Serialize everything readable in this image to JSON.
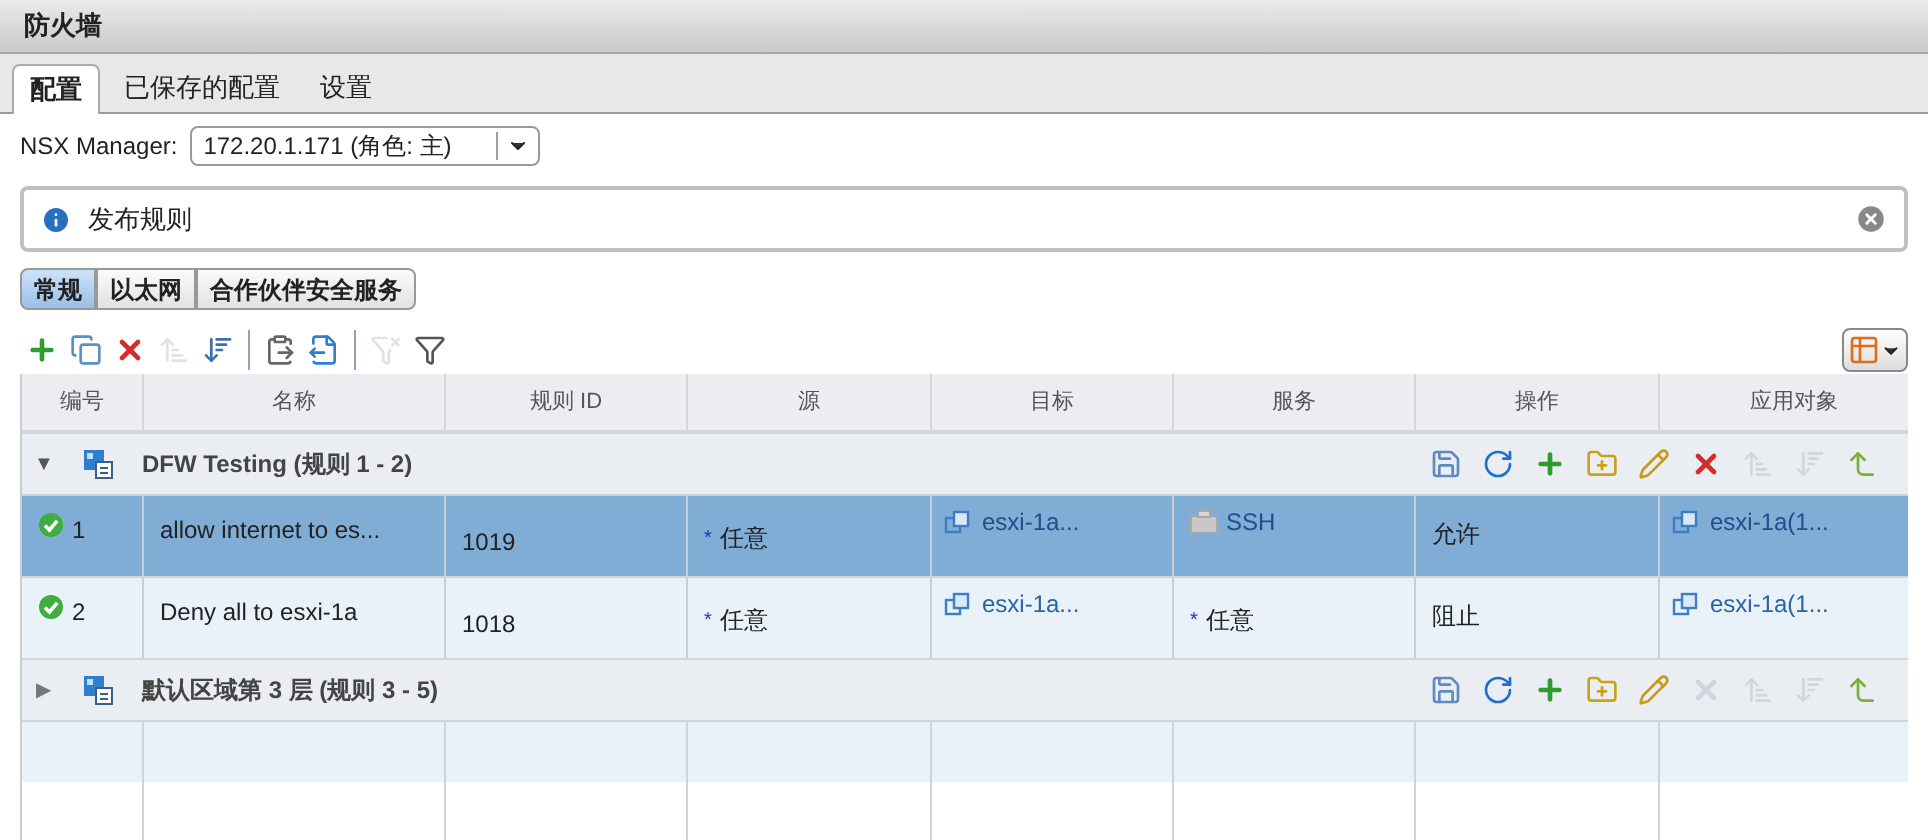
{
  "window": {
    "title": "防火墙"
  },
  "tabs": [
    {
      "label": "配置",
      "selected": true
    },
    {
      "label": "已保存的配置",
      "selected": false
    },
    {
      "label": "设置",
      "selected": false
    }
  ],
  "nsx_manager": {
    "label": "NSX Manager:",
    "value": "172.20.1.171 (角色: 主)"
  },
  "info_bar": {
    "message": "发布规则"
  },
  "section_tabs": [
    {
      "label": "常规",
      "selected": true
    },
    {
      "label": "以太网",
      "selected": false
    },
    {
      "label": "合作伙伴安全服务",
      "selected": false
    }
  ],
  "toolbar_groups": [
    {
      "buttons": [
        {
          "kind": "add",
          "disabled": false
        },
        {
          "kind": "copy",
          "disabled": false
        },
        {
          "kind": "delete",
          "disabled": false
        },
        {
          "kind": "move_up",
          "disabled": true
        },
        {
          "kind": "move_down",
          "disabled": false
        }
      ]
    },
    {
      "buttons": [
        {
          "kind": "paste",
          "disabled": false
        },
        {
          "kind": "export",
          "disabled": false
        }
      ]
    },
    {
      "buttons": [
        {
          "kind": "clear_filter",
          "disabled": true
        },
        {
          "kind": "add_filter",
          "disabled": false
        }
      ]
    }
  ],
  "table": {
    "columns": [
      "编号",
      "名称",
      "规则 ID",
      "源",
      "目标",
      "服务",
      "操作",
      "应用对象"
    ],
    "sections": [
      {
        "title": "DFW Testing (规则 1 - 2)",
        "expanded": true,
        "toggle": "▼",
        "actions": [
          {
            "kind": "save",
            "disabled": false
          },
          {
            "kind": "refresh",
            "disabled": false
          },
          {
            "kind": "add",
            "disabled": false
          },
          {
            "kind": "add_section",
            "disabled": false
          },
          {
            "kind": "edit",
            "disabled": false
          },
          {
            "kind": "delete",
            "disabled": false
          },
          {
            "kind": "move_up",
            "disabled": true
          },
          {
            "kind": "move_down",
            "disabled": true
          },
          {
            "kind": "promote",
            "disabled": false
          }
        ],
        "rules": [
          {
            "number": "1",
            "enabled": true,
            "selected": true,
            "name": "allow internet to es...",
            "rule_id": "1019",
            "source": {
              "kind": "any",
              "mark": "*",
              "text": "任意"
            },
            "destination": {
              "kind": "object",
              "text": "esxi-1a..."
            },
            "service": {
              "kind": "service",
              "text": "SSH"
            },
            "action": "允许",
            "applied_to": {
              "kind": "object",
              "text": "esxi-1a(1..."
            }
          },
          {
            "number": "2",
            "enabled": true,
            "selected": false,
            "name": "Deny all to esxi-1a",
            "rule_id": "1018",
            "source": {
              "kind": "any",
              "mark": "*",
              "text": "任意"
            },
            "destination": {
              "kind": "object",
              "text": "esxi-1a..."
            },
            "service": {
              "kind": "any",
              "mark": "*",
              "text": "任意"
            },
            "action": "阻止",
            "applied_to": {
              "kind": "object",
              "text": "esxi-1a(1..."
            }
          }
        ]
      },
      {
        "title": "默认区域第 3 层 (规则 3 - 5)",
        "expanded": false,
        "toggle": "▶",
        "actions": [
          {
            "kind": "save",
            "disabled": false
          },
          {
            "kind": "refresh",
            "disabled": false
          },
          {
            "kind": "add",
            "disabled": false
          },
          {
            "kind": "add_section",
            "disabled": false
          },
          {
            "kind": "edit",
            "disabled": false
          },
          {
            "kind": "delete",
            "disabled": true
          },
          {
            "kind": "move_up",
            "disabled": true
          },
          {
            "kind": "move_down",
            "disabled": true
          },
          {
            "kind": "promote",
            "disabled": false
          }
        ]
      }
    ]
  }
}
